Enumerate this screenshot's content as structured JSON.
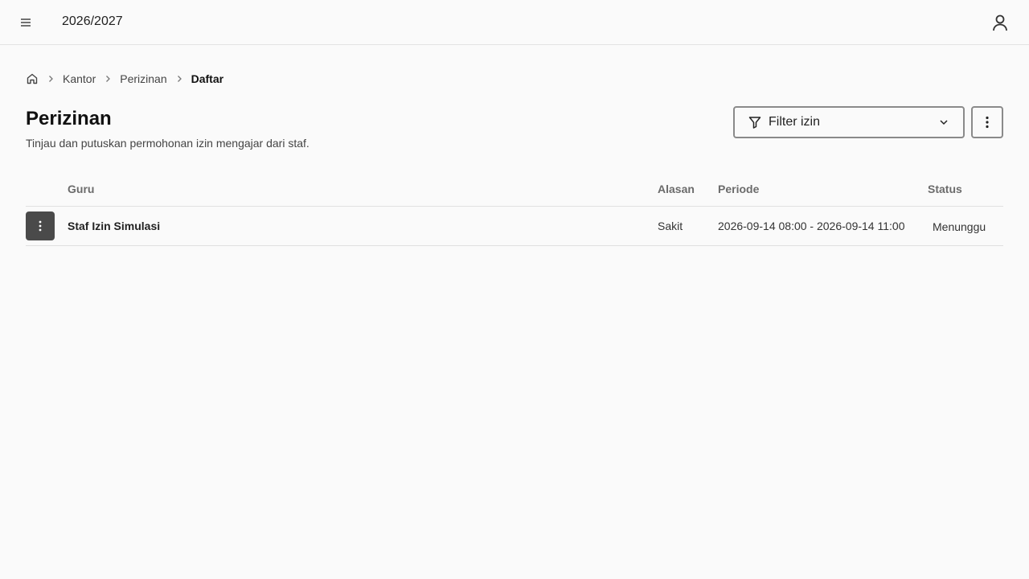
{
  "header": {
    "year": "2026/2027",
    "menu_icon": "hamburger-menu-icon",
    "user_icon": "user-icon"
  },
  "breadcrumb": {
    "home_icon": "home-icon",
    "items": [
      "Kantor",
      "Perizinan",
      "Daftar"
    ]
  },
  "page": {
    "title": "Perizinan",
    "subtitle": "Tinjau dan putuskan permohonan izin mengajar dari staf."
  },
  "toolbar": {
    "filter_label": "Filter izin",
    "filter_icon": "filter-icon",
    "more_icon": "more-vertical-icon"
  },
  "table": {
    "columns": [
      "Guru",
      "Alasan",
      "Periode",
      "Status"
    ],
    "rows": [
      {
        "guru": "Staf Izin Simulasi",
        "alasan": "Sakit",
        "periode": "2026-09-14 08:00 - 2026-09-14 11:00",
        "status": "Menunggu"
      }
    ]
  },
  "colors": {
    "background": "#fafafa",
    "row_action": "#4a4a4a",
    "border": "#8a8a8a"
  }
}
